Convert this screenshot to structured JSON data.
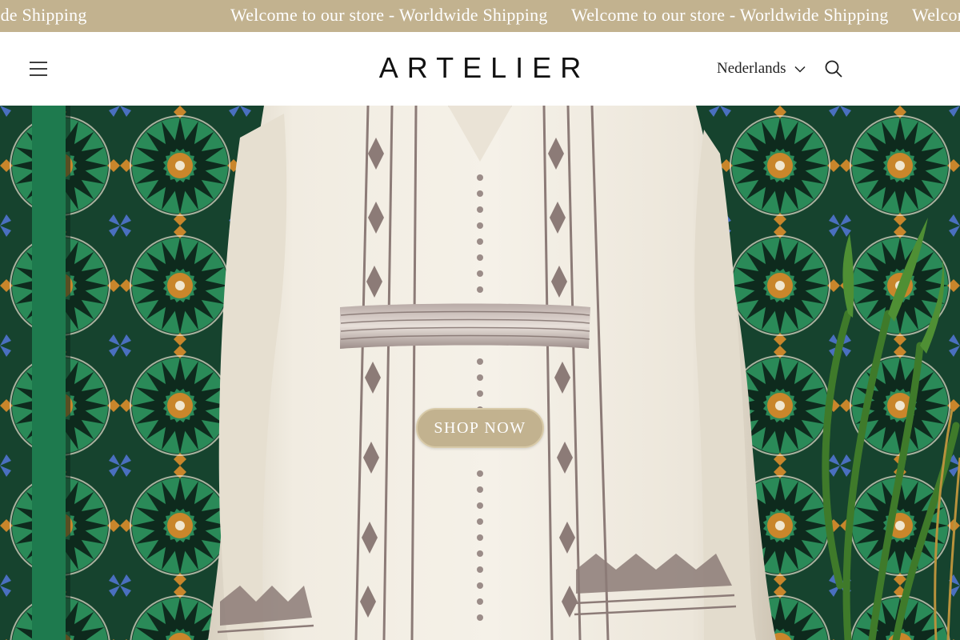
{
  "announcement": {
    "items": [
      "Welcome to our store - Worldwide Shipping",
      "Welcome to our store - Worldwide Shipping",
      "Welcome to our store - Worldwide Shipping",
      "Welcome to our store - Worldwide Shipping"
    ]
  },
  "header": {
    "logo": "ARTELIER",
    "language_label": "Nederlands",
    "menu_icon": "hamburger-menu-icon",
    "search_icon": "search-icon",
    "language_icon": "chevron-down-icon"
  },
  "hero": {
    "cta_label": "SHOP NOW"
  },
  "colors": {
    "announcement_bg": "#c2b28f",
    "button_bg": "#c2b28f",
    "text_dark": "#111111",
    "tile_green": "#1e7a4e",
    "tile_blue": "#4a6fc0",
    "tile_orange": "#c9862b",
    "dress_cream": "#efe9dc",
    "embroidery": "#8c7b77"
  }
}
